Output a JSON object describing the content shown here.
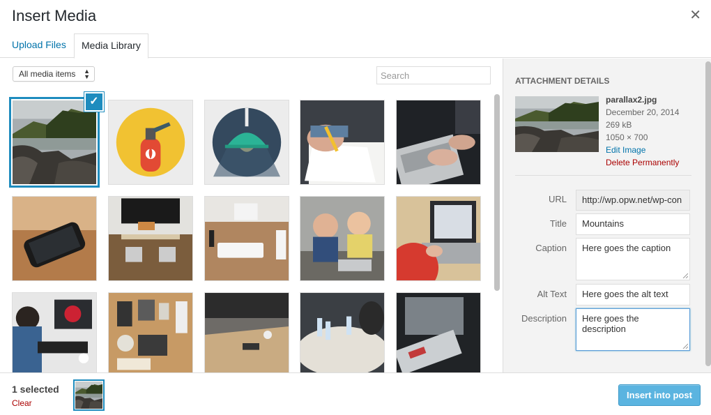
{
  "modal": {
    "title": "Insert Media",
    "close_icon": "close-icon"
  },
  "tabs": [
    {
      "label": "Upload Files",
      "active": false
    },
    {
      "label": "Media Library",
      "active": true
    }
  ],
  "filter": {
    "selected": "All media items"
  },
  "search": {
    "placeholder": "Search"
  },
  "grid": {
    "items": [
      {
        "subject": "mountains-river",
        "selected": true
      },
      {
        "subject": "fire-extinguisher-icon"
      },
      {
        "subject": "lamp-icon"
      },
      {
        "subject": "hand-writing-notebook"
      },
      {
        "subject": "hands-on-laptop"
      },
      {
        "subject": "smartphone-on-wood"
      },
      {
        "subject": "desk-with-monitor"
      },
      {
        "subject": "keyboard-on-desk"
      },
      {
        "subject": "kids-with-laptop"
      },
      {
        "subject": "person-using-laptop"
      },
      {
        "subject": "person-at-computer"
      },
      {
        "subject": "flat-lay-items"
      },
      {
        "subject": "office-table"
      },
      {
        "subject": "meeting-table-bottles"
      },
      {
        "subject": "laptop-in-dark"
      }
    ]
  },
  "attachment": {
    "heading": "ATTACHMENT DETAILS",
    "filename": "parallax2.jpg",
    "date": "December 20, 2014",
    "size": "269 kB",
    "dimensions": "1050 × 700",
    "edit_label": "Edit Image",
    "delete_label": "Delete Permanently",
    "fields": {
      "url": {
        "label": "URL",
        "value": "http://wp.opw.net/wp-con"
      },
      "title": {
        "label": "Title",
        "value": "Mountains"
      },
      "caption": {
        "label": "Caption",
        "value": "Here goes the caption"
      },
      "alt": {
        "label": "Alt Text",
        "value": "Here goes the alt text"
      },
      "description": {
        "label": "Description",
        "value": "Here goes the description"
      }
    }
  },
  "footer": {
    "selected_count": "1 selected",
    "clear_label": "Clear",
    "insert_label": "Insert into post"
  },
  "colors": {
    "accent": "#1e8cbe",
    "link": "#0073aa",
    "danger": "#aa0000",
    "primary_button": "#5bb4e0"
  }
}
